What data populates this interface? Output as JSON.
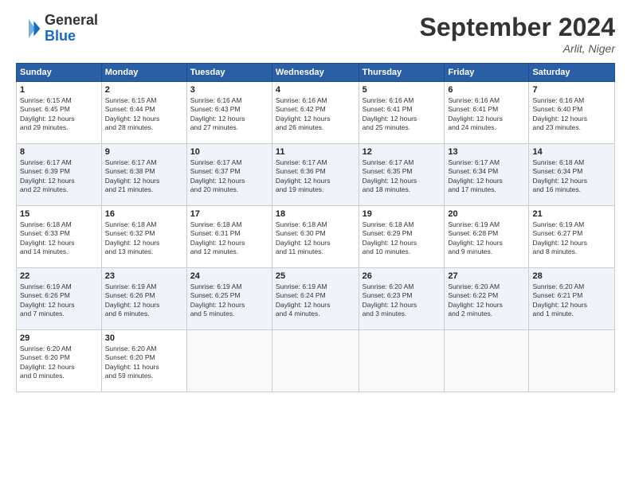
{
  "header": {
    "logo_line1": "General",
    "logo_line2": "Blue",
    "month": "September 2024",
    "location": "Arlit, Niger"
  },
  "weekdays": [
    "Sunday",
    "Monday",
    "Tuesday",
    "Wednesday",
    "Thursday",
    "Friday",
    "Saturday"
  ],
  "weeks": [
    [
      {
        "day": "1",
        "info": "Sunrise: 6:15 AM\nSunset: 6:45 PM\nDaylight: 12 hours\nand 29 minutes."
      },
      {
        "day": "2",
        "info": "Sunrise: 6:15 AM\nSunset: 6:44 PM\nDaylight: 12 hours\nand 28 minutes."
      },
      {
        "day": "3",
        "info": "Sunrise: 6:16 AM\nSunset: 6:43 PM\nDaylight: 12 hours\nand 27 minutes."
      },
      {
        "day": "4",
        "info": "Sunrise: 6:16 AM\nSunset: 6:42 PM\nDaylight: 12 hours\nand 26 minutes."
      },
      {
        "day": "5",
        "info": "Sunrise: 6:16 AM\nSunset: 6:41 PM\nDaylight: 12 hours\nand 25 minutes."
      },
      {
        "day": "6",
        "info": "Sunrise: 6:16 AM\nSunset: 6:41 PM\nDaylight: 12 hours\nand 24 minutes."
      },
      {
        "day": "7",
        "info": "Sunrise: 6:16 AM\nSunset: 6:40 PM\nDaylight: 12 hours\nand 23 minutes."
      }
    ],
    [
      {
        "day": "8",
        "info": "Sunrise: 6:17 AM\nSunset: 6:39 PM\nDaylight: 12 hours\nand 22 minutes."
      },
      {
        "day": "9",
        "info": "Sunrise: 6:17 AM\nSunset: 6:38 PM\nDaylight: 12 hours\nand 21 minutes."
      },
      {
        "day": "10",
        "info": "Sunrise: 6:17 AM\nSunset: 6:37 PM\nDaylight: 12 hours\nand 20 minutes."
      },
      {
        "day": "11",
        "info": "Sunrise: 6:17 AM\nSunset: 6:36 PM\nDaylight: 12 hours\nand 19 minutes."
      },
      {
        "day": "12",
        "info": "Sunrise: 6:17 AM\nSunset: 6:35 PM\nDaylight: 12 hours\nand 18 minutes."
      },
      {
        "day": "13",
        "info": "Sunrise: 6:17 AM\nSunset: 6:34 PM\nDaylight: 12 hours\nand 17 minutes."
      },
      {
        "day": "14",
        "info": "Sunrise: 6:18 AM\nSunset: 6:34 PM\nDaylight: 12 hours\nand 16 minutes."
      }
    ],
    [
      {
        "day": "15",
        "info": "Sunrise: 6:18 AM\nSunset: 6:33 PM\nDaylight: 12 hours\nand 14 minutes."
      },
      {
        "day": "16",
        "info": "Sunrise: 6:18 AM\nSunset: 6:32 PM\nDaylight: 12 hours\nand 13 minutes."
      },
      {
        "day": "17",
        "info": "Sunrise: 6:18 AM\nSunset: 6:31 PM\nDaylight: 12 hours\nand 12 minutes."
      },
      {
        "day": "18",
        "info": "Sunrise: 6:18 AM\nSunset: 6:30 PM\nDaylight: 12 hours\nand 11 minutes."
      },
      {
        "day": "19",
        "info": "Sunrise: 6:18 AM\nSunset: 6:29 PM\nDaylight: 12 hours\nand 10 minutes."
      },
      {
        "day": "20",
        "info": "Sunrise: 6:19 AM\nSunset: 6:28 PM\nDaylight: 12 hours\nand 9 minutes."
      },
      {
        "day": "21",
        "info": "Sunrise: 6:19 AM\nSunset: 6:27 PM\nDaylight: 12 hours\nand 8 minutes."
      }
    ],
    [
      {
        "day": "22",
        "info": "Sunrise: 6:19 AM\nSunset: 6:26 PM\nDaylight: 12 hours\nand 7 minutes."
      },
      {
        "day": "23",
        "info": "Sunrise: 6:19 AM\nSunset: 6:26 PM\nDaylight: 12 hours\nand 6 minutes."
      },
      {
        "day": "24",
        "info": "Sunrise: 6:19 AM\nSunset: 6:25 PM\nDaylight: 12 hours\nand 5 minutes."
      },
      {
        "day": "25",
        "info": "Sunrise: 6:19 AM\nSunset: 6:24 PM\nDaylight: 12 hours\nand 4 minutes."
      },
      {
        "day": "26",
        "info": "Sunrise: 6:20 AM\nSunset: 6:23 PM\nDaylight: 12 hours\nand 3 minutes."
      },
      {
        "day": "27",
        "info": "Sunrise: 6:20 AM\nSunset: 6:22 PM\nDaylight: 12 hours\nand 2 minutes."
      },
      {
        "day": "28",
        "info": "Sunrise: 6:20 AM\nSunset: 6:21 PM\nDaylight: 12 hours\nand 1 minute."
      }
    ],
    [
      {
        "day": "29",
        "info": "Sunrise: 6:20 AM\nSunset: 6:20 PM\nDaylight: 12 hours\nand 0 minutes."
      },
      {
        "day": "30",
        "info": "Sunrise: 6:20 AM\nSunset: 6:20 PM\nDaylight: 11 hours\nand 59 minutes."
      },
      {
        "day": "",
        "info": ""
      },
      {
        "day": "",
        "info": ""
      },
      {
        "day": "",
        "info": ""
      },
      {
        "day": "",
        "info": ""
      },
      {
        "day": "",
        "info": ""
      }
    ]
  ]
}
